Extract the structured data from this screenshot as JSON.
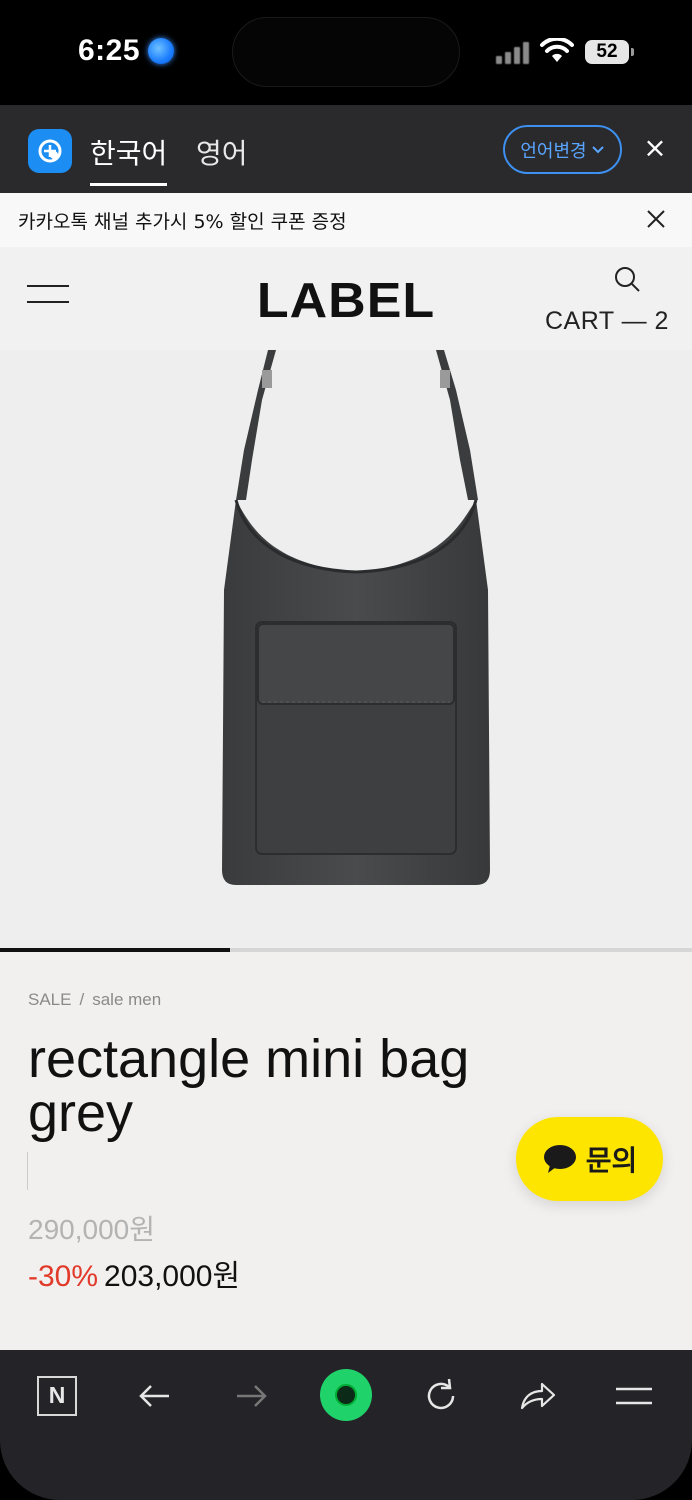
{
  "status_bar": {
    "time": "6:25",
    "battery": "52"
  },
  "translate_bar": {
    "lang_source": "한국어",
    "lang_target": "영어",
    "change_language": "언어변경",
    "close": "×"
  },
  "promo": {
    "text": "카카오톡 채널 추가시 5% 할인 쿠폰 증정"
  },
  "header": {
    "logo": "LABEL",
    "cart": "CART — 2"
  },
  "gallery": {
    "progress": 0.333
  },
  "product": {
    "breadcrumb": [
      "SALE",
      "sale men"
    ],
    "breadcrumb_sep": "/",
    "title_line1": "rectangle mini bag",
    "title_line2": "grey",
    "original_price": "290,000원",
    "discount": "-30%",
    "sale_price": "203,000원"
  },
  "inquiry": {
    "label": "문의"
  },
  "colors": {
    "accent_blue": "#3d8ff0",
    "discount_red": "#e23a2a",
    "kakao_yellow": "#fee500",
    "naver_green": "#1fd36a"
  },
  "icons": [
    "location-icon",
    "signal-icon",
    "wifi-icon",
    "battery-icon",
    "papago-icon",
    "chevron-down-icon",
    "close-icon",
    "hamburger-icon",
    "search-icon",
    "chat-bubble-icon",
    "naver-n-icon",
    "back-arrow-icon",
    "forward-arrow-icon",
    "green-dot-icon",
    "reload-icon",
    "share-icon",
    "menu-icon"
  ]
}
